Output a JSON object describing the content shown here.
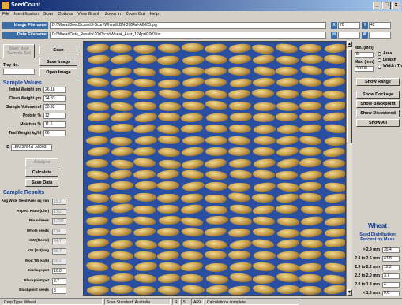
{
  "window": {
    "title": "SeedCount"
  },
  "menu": [
    "File",
    "Identification",
    "Scan",
    "Options",
    "View Graph",
    "Zoom In",
    "Zoom Out",
    "Help"
  ],
  "paths": {
    "image_label": "Image Filename",
    "image_value": "D:\\Wheat\\SeedScans\\3-Scan\\Wheat\\LBN-3784al-A6003.jpg",
    "data_label": "Data Filename",
    "data_value": "D:\\Wheat\\Data_Results\\2003\\cnt\\Wheat_Aust_12April2003.txt"
  },
  "coords": {
    "x_label": "X",
    "x_value": "70",
    "y_label": "Y",
    "y_value": "42",
    "h_label": "H",
    "h_value": "",
    "w_label": "W",
    "w_value": ""
  },
  "left": {
    "start_new": "Start New Sample Set",
    "scan": "Scan",
    "tray_label": "Tray No.",
    "save_image": "Save Image",
    "open_image": "Open Image",
    "sample_values_title": "Sample Values",
    "fields": [
      {
        "label": "Initial Weight gm",
        "value": "26.18"
      },
      {
        "label": "Clean Weight gm",
        "value": "24.83"
      },
      {
        "label": "Sample Volume ml",
        "value": "30.92"
      },
      {
        "label": "Protein %",
        "value": "12"
      },
      {
        "label": "Moisture %",
        "value": "11.5"
      },
      {
        "label": "Test Weight kg/hl",
        "value": "66"
      }
    ],
    "id_label": "ID",
    "id_value": "LBN-3784al-A6003",
    "analyse": "Analyse",
    "calculate": "Calculate",
    "save_data": "Save Data",
    "sample_results_title": "Sample Results",
    "results": [
      {
        "label": "Avg Wide Seed Area sq mm",
        "value": "15.2"
      },
      {
        "label": "Aspect Ratio (L/W)",
        "value": "1.62"
      },
      {
        "label": "Roundness",
        "value": "1.739"
      },
      {
        "label": "Whole seeds",
        "value": "714"
      },
      {
        "label": "KW (No ml)",
        "value": "34.7"
      },
      {
        "label": "KW (Est) mg",
        "value": "30.7"
      },
      {
        "label": "Mod TW kg/hl",
        "value": "65.6"
      },
      {
        "label": "Dockage pct",
        "value": "10.8"
      },
      {
        "label": "Blackpoint pct",
        "value": "8.7"
      },
      {
        "label": "Blackpoint seeds",
        "value": "3"
      }
    ]
  },
  "right": {
    "min_label": "Min. (mm)",
    "min_value": "8",
    "max_label": "Max. (mm)",
    "max_value": "30000",
    "opt_area": "Area",
    "opt_length": "Length",
    "opt_width": "Width / Thickne",
    "show_range": "Show Range",
    "show_dockage": "Show Dockage",
    "show_blackpoint": "Show Blackpoint",
    "show_discolored": "Show Discolored",
    "show_all": "Show All",
    "crop": "Wheat",
    "dist_title": "Seed Distribution Percent by Mass",
    "dist": [
      {
        "label": "> 2.9 mm",
        "value": "35.4"
      },
      {
        "label": "2.8 to 2.5 mm",
        "value": "43.8"
      },
      {
        "label": "2.5 to 2.2 mm",
        "value": "12.2"
      },
      {
        "label": "2.2 to 2.0 mm",
        "value": "3.7"
      },
      {
        "label": "2.0 to 1.8 mm",
        "value": "4"
      },
      {
        "label": "< 1.6 mm",
        "value": "0.6"
      }
    ]
  },
  "status": {
    "crop_type": "Crop Type: Wheat",
    "standard": "Scan Standard: Australia",
    "r": "R",
    "r_val": "5",
    "ave": "A69",
    "msg": "Calculations complete"
  },
  "colors": {
    "title_bar": "#0a246a",
    "image_bg": "#2a4fa0",
    "section_title": "#1040a0"
  }
}
